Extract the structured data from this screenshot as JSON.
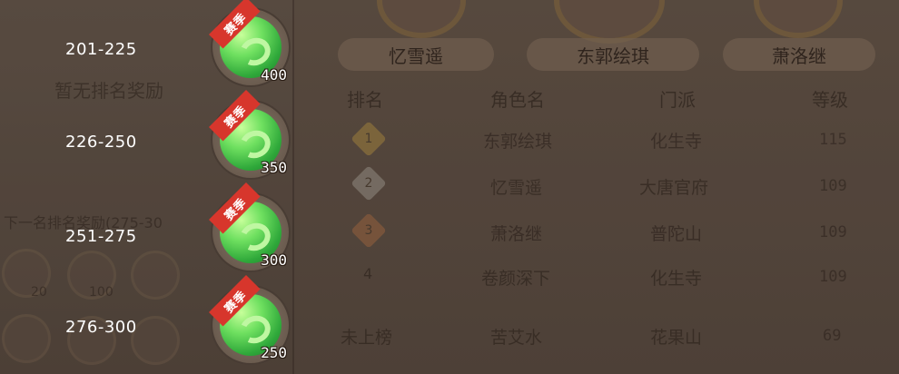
{
  "right_panel": {
    "name_plates": [
      "忆雪遥",
      "东郭绘琪",
      "萧洛继"
    ],
    "headers": [
      "排名",
      "角色名",
      "门派",
      "等级"
    ],
    "rows": [
      {
        "rank": "1",
        "name": "东郭绘琪",
        "school": "化生寺",
        "level": "115"
      },
      {
        "rank": "2",
        "name": "忆雪遥",
        "school": "大唐官府",
        "level": "109"
      },
      {
        "rank": "3",
        "name": "萧洛继",
        "school": "普陀山",
        "level": "109"
      },
      {
        "rank": "4",
        "name": "卷颜深下",
        "school": "化生寺",
        "level": "109"
      },
      {
        "rank": "未上榜",
        "name": "苦艾水",
        "school": "花果山",
        "level": "69"
      }
    ]
  },
  "left_panel": {
    "no_reward_text": "暂无排名奖励",
    "next_reward_text": "下一名排名奖励(275-30",
    "item_counts": [
      "20",
      "100"
    ]
  },
  "reward_tiers": [
    {
      "range": "201-225",
      "badge": "赛季",
      "quantity": "400"
    },
    {
      "range": "226-250",
      "badge": "赛季",
      "quantity": "350"
    },
    {
      "range": "251-275",
      "badge": "赛季",
      "quantity": "300"
    },
    {
      "range": "276-300",
      "badge": "赛季",
      "quantity": "250"
    }
  ],
  "colors": {
    "ribbon": "#d7362c",
    "jade": "#4fcf4a",
    "text": "#ffffff"
  }
}
